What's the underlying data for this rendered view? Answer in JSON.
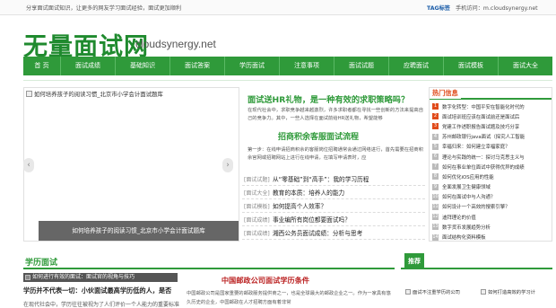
{
  "topbar": {
    "tip": "分享面试面试知识，让更多的网友学习面试经验，面试更加顺利",
    "tags": "TAG标签",
    "mobile": "手机访问：m.cloudsynergy.net"
  },
  "logo": {
    "cn": "无量面试网",
    "en": "cloudsynergy.net"
  },
  "nav": [
    "首 页",
    "面试成绩",
    "基础知识",
    "面试答案",
    "学历面试",
    "注意事项",
    "面试试题",
    "应聘面试",
    "面试模板",
    "面试大全"
  ],
  "slider": {
    "image_alt": "如何培养孩子的阅读习惯_北京市小学会计面试题库",
    "caption": "如何培养孩子的阅读习惯_北京市小学会计面试题库",
    "prev": "‹",
    "next": "›"
  },
  "featured": {
    "headline": "面试送HR礼物，是一种有效的求职策略吗？",
    "lead": "在现代社会中，求职竞争越来越激烈，许多求职者都在寻找一些创新的方法来提高自己的竞争力。其中，一些人选择在面试前给HR送礼物，希望能够",
    "headline2": "招商积余客服面试流程",
    "lead2": "第一步：在线申请招商积余的客服岗位招聘通常会通过网络进行，首先需要在招商积余官网或招聘网站上进行在线申请，在填写申请表时，应"
  },
  "list": [
    {
      "cat": "[面试试题]",
      "title": "从“零基础”到“高手”：我的学习历程"
    },
    {
      "cat": "[面试大全]",
      "title": "教育的本质：培养人的能力"
    },
    {
      "cat": "[面试模板]",
      "title": "如何提高个人效率？"
    },
    {
      "cat": "[面试成绩]",
      "title": "事业编所有岗位都要面试吗？"
    },
    {
      "cat": "[面试成绩]",
      "title": "湘西公务员面试成绩：分析与思考"
    }
  ],
  "hot": {
    "title": "热门信息",
    "items": [
      "数字化转型：中国平安在智能化时代的",
      "面试培训班应该在面试前还是面试后",
      "党建工作述职报告面试题及技巧分享",
      "苏州邮政银行java面试（探究人工智能",
      "幸福归来：如何建立幸福家庭？",
      "理论与实践的统一：探讨马克思主义与",
      "如何在事业单位面试中获得优异的成绩",
      "如何优化iOS应用的性能",
      "全面发展卫生健康领域",
      "如何在面试中与人沟通？",
      "如何设计一个高效的搜索引擎？",
      "迪拜理论的价值",
      "数字货币发展趋势分析",
      "面试结构化资料模板"
    ]
  },
  "section": {
    "title": "学历面试",
    "thumb_alt": "如何进行有效的面试：面试官的视角与技巧",
    "t1": "学历并不代表一切：小伙面试最高学历低的人，是否",
    "t1b": "在现代社会中，学历往往被视为了人们评价一个人能力的重要标准",
    "center_title": "中国邮政公司面试学历条件",
    "center_body": "中国邮政公司是国家重要的邮政服务提供商之一，也是全球最大的邮政企业之一。作为一家具有悠久历史的企业，中国邮政在人才招聘方面有着非常",
    "rec": "推荐",
    "rec_a": "面试不注重学历的公司",
    "rec_b": "如何打造高效的学习计"
  }
}
